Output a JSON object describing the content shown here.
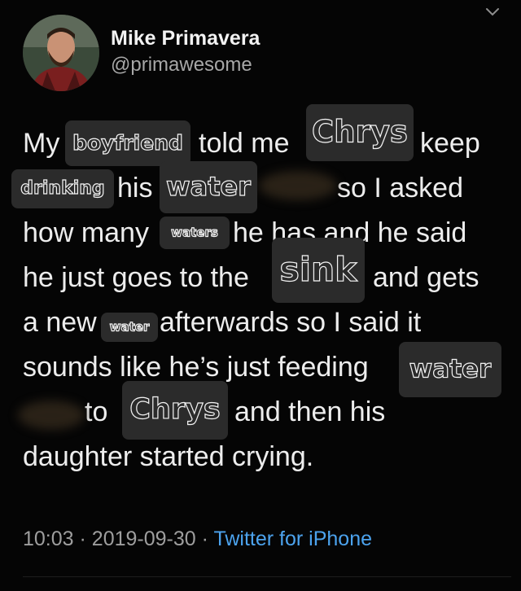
{
  "author": {
    "name": "Mike Primavera",
    "handle": "@primawesome",
    "avatar_icon": "avatar-photo"
  },
  "menu_icon": "chevron-down-icon",
  "tweet": {
    "lines": [
      {
        "parts": [
          "My",
          "told me",
          "keep"
        ]
      },
      {
        "parts": [
          "his",
          "so I asked"
        ]
      },
      {
        "parts": [
          "how many",
          "he has and he said"
        ]
      },
      {
        "parts": [
          "he just goes to the",
          "and gets"
        ]
      },
      {
        "parts": [
          "a new",
          "afterwards so I said it"
        ]
      },
      {
        "parts": [
          "sounds like he’s just feeding"
        ]
      },
      {
        "parts": [
          "to",
          "and then his"
        ]
      },
      {
        "parts": [
          "daughter started crying."
        ]
      }
    ],
    "stickers": [
      "boyfriend",
      "Chrys",
      "drinking",
      "water",
      "waters",
      "sink",
      "water",
      "water",
      "Chrys"
    ]
  },
  "meta": {
    "time": "10:03",
    "separator": "·",
    "date": "2019-09-30",
    "source": "Twitter for iPhone"
  },
  "colors": {
    "background": "#050505",
    "text": "#ededed",
    "muted": "#9e9e9e",
    "link": "#4ca3ee",
    "sticker": "#2b2b2b"
  }
}
